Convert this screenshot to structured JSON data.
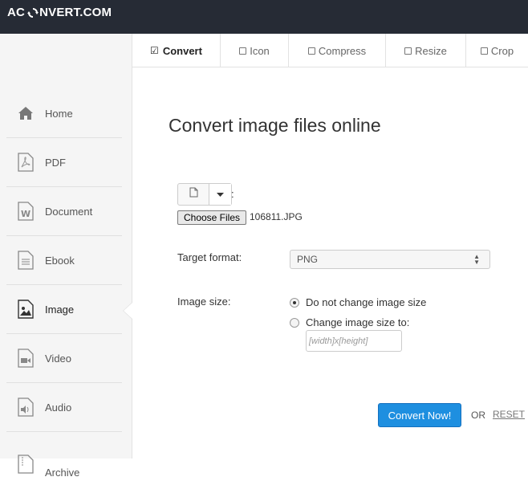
{
  "logo": {
    "pre": "AC",
    "post": "NVERT.COM"
  },
  "sidebar": {
    "items": [
      {
        "label": "Home",
        "icon": "home-icon"
      },
      {
        "label": "PDF",
        "icon": "pdf-icon"
      },
      {
        "label": "Document",
        "icon": "document-icon"
      },
      {
        "label": "Ebook",
        "icon": "ebook-icon"
      },
      {
        "label": "Image",
        "icon": "image-icon"
      },
      {
        "label": "Video",
        "icon": "video-icon"
      },
      {
        "label": "Audio",
        "icon": "audio-icon"
      },
      {
        "label": "Archive",
        "icon": "archive-icon"
      }
    ],
    "active": "Image"
  },
  "tabs": [
    {
      "label": "Convert",
      "active": true
    },
    {
      "label": "Icon"
    },
    {
      "label": "Compress"
    },
    {
      "label": "Resize"
    },
    {
      "label": "Crop"
    }
  ],
  "main": {
    "title": "Convert image files online",
    "file_colon": ":",
    "choose_files": "Choose Files",
    "filename": "106811.JPG",
    "target_format_label": "Target format:",
    "target_format_value": "PNG",
    "image_size_label": "Image size:",
    "size_option_1": "Do not change image size",
    "size_option_2": "Change image size to:",
    "size_placeholder": "[width]x[height]",
    "convert_button": "Convert Now!",
    "or": "OR",
    "reset": "RESET"
  },
  "colors": {
    "topbar": "#262b35",
    "primary_button": "#1e8fe0"
  }
}
